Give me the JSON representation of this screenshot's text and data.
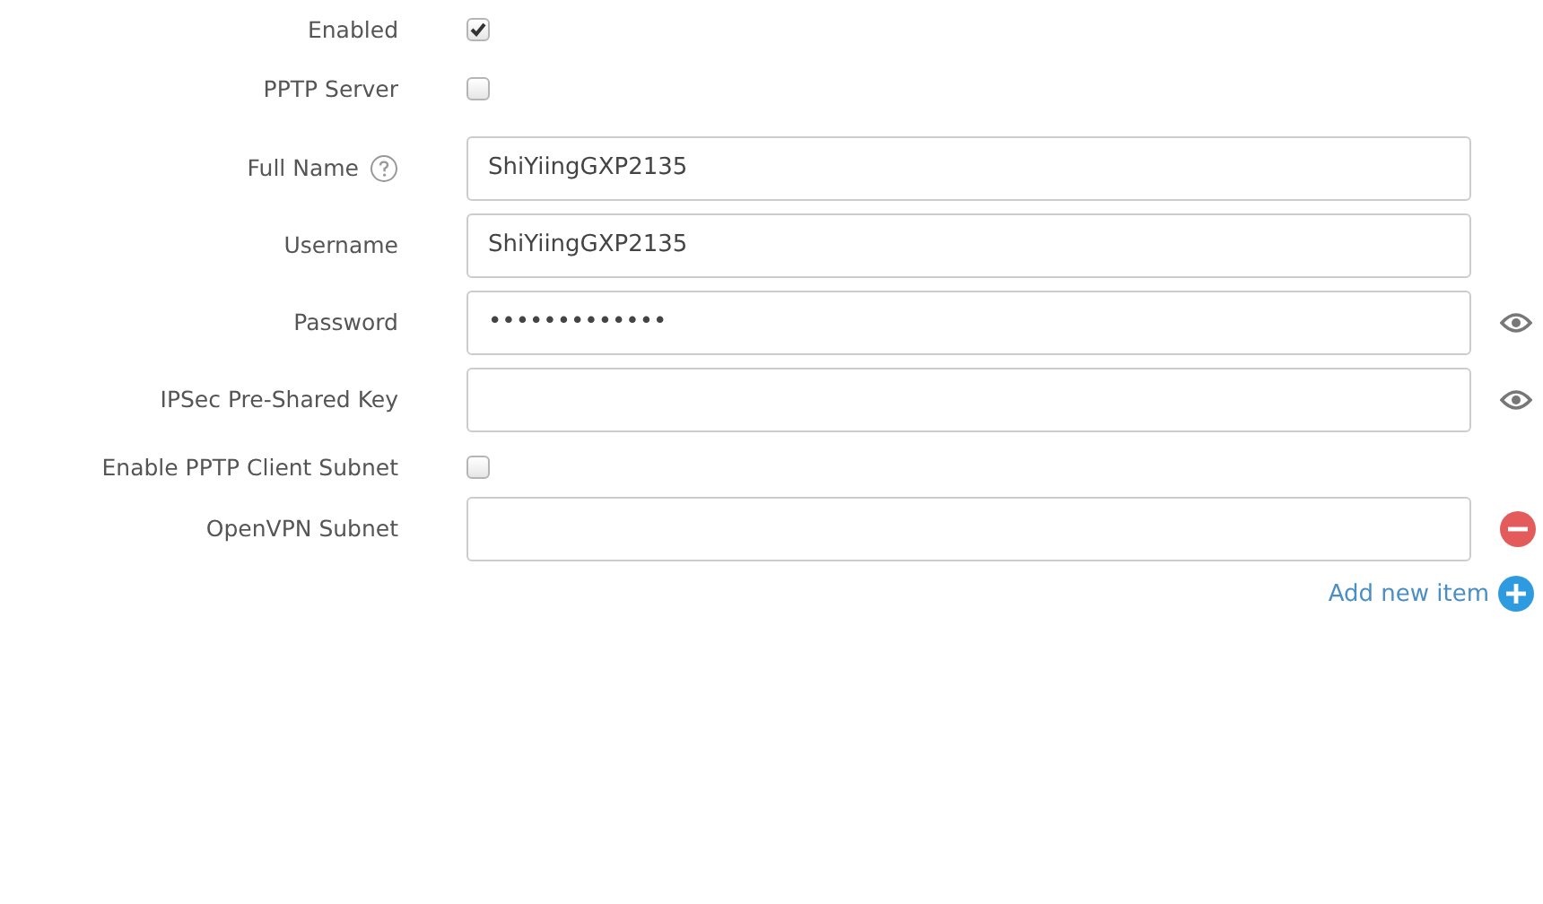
{
  "fields": [
    {
      "kind": "checkbox",
      "label": "Enabled",
      "checked": true
    },
    {
      "kind": "checkbox",
      "label": "PPTP Server",
      "checked": false
    },
    {
      "kind": "text",
      "label": "Full Name",
      "help": true,
      "value": "ShiYiingGXP2135"
    },
    {
      "kind": "text",
      "label": "Username",
      "value": "ShiYiingGXP2135"
    },
    {
      "kind": "text",
      "label": "Password",
      "value": "•••••••••••••",
      "trailing": {
        "kind": "reveal"
      }
    },
    {
      "kind": "text",
      "label": "IPSec Pre-Shared Key",
      "trailing": {
        "kind": "reveal"
      }
    },
    {
      "kind": "checkbox",
      "label": "Enable PPTP Client Subnet",
      "checked": false
    },
    {
      "kind": "text",
      "label": "OpenVPN Subnet",
      "trailing": {
        "kind": "remove"
      }
    }
  ],
  "add_link": {
    "label": "Add new item"
  }
}
